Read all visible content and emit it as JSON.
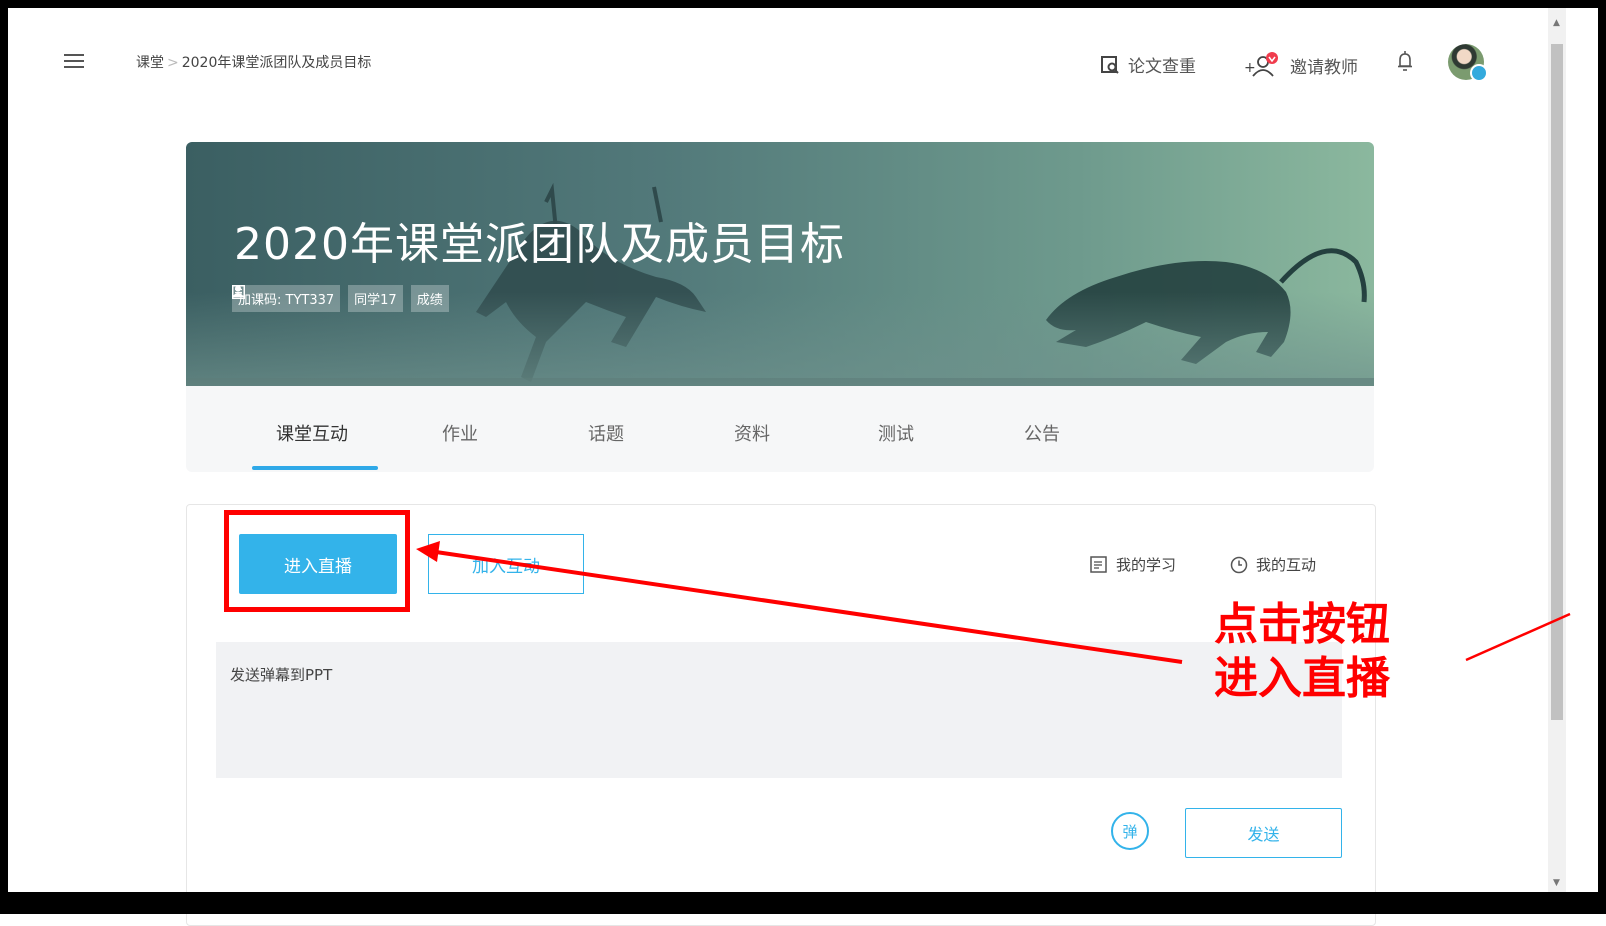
{
  "header": {
    "breadcrumb": {
      "root": "课堂",
      "separator": ">",
      "current": "2020年课堂派团队及成员目标"
    },
    "check_paper_label": "论文查重",
    "invite_teacher_label": "邀请教师"
  },
  "course": {
    "title": "2020年课堂派团队及成员目标",
    "code_label": "加课码: TYT337",
    "students_label": "同学17",
    "grades_label": "成绩"
  },
  "tabs": [
    {
      "label": "课堂互动",
      "active": true
    },
    {
      "label": "作业"
    },
    {
      "label": "话题"
    },
    {
      "label": "资料"
    },
    {
      "label": "测试"
    },
    {
      "label": "公告"
    }
  ],
  "actions": {
    "enter_live_label": "进入直播",
    "join_interaction_label": "加入互动",
    "my_study_label": "我的学习",
    "my_interaction_label": "我的互动"
  },
  "message": {
    "placeholder": "发送弹幕到PPT",
    "danmaku_label": "弹",
    "send_label": "发送"
  },
  "annotation": {
    "line1": "点击按钮",
    "line2": "进入直播"
  },
  "colors": {
    "accent": "#33b3ea",
    "annotation": "#ff0000"
  }
}
